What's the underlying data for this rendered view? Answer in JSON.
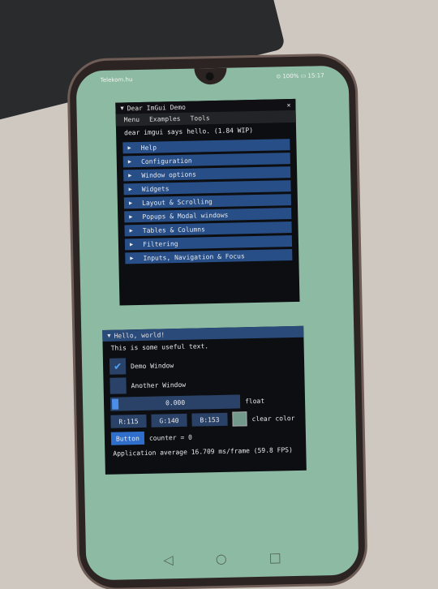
{
  "status": {
    "left": "Telekom.hu",
    "right": "⊙ 100% ▭ 15:17"
  },
  "demo_window": {
    "title": "Dear ImGui Demo",
    "close_glyph": "✕",
    "menu": [
      "Menu",
      "Examples",
      "Tools"
    ],
    "hello_line": "dear imgui says hello. (1.84 WIP)",
    "headers": [
      "Help",
      "Configuration",
      "Window options",
      "Widgets",
      "Layout & Scrolling",
      "Popups & Modal windows",
      "Tables & Columns",
      "Filtering",
      "Inputs, Navigation & Focus"
    ]
  },
  "hello_window": {
    "title": "Hello, world!",
    "text": "This is some useful text.",
    "check_demo": {
      "label": "Demo Window",
      "checked": true
    },
    "check_another": {
      "label": "Another Window",
      "checked": false
    },
    "slider": {
      "value": "0.000",
      "label": "float"
    },
    "color": {
      "r": "R:115",
      "g": "G:140",
      "b": "B:153",
      "label": "clear color",
      "swatch": "#73998c"
    },
    "button_label": "Button",
    "counter": "counter = 0",
    "perf": "Application average 16.709 ms/frame (59.8 FPS)"
  },
  "nav": {
    "back": "◁",
    "home": "○",
    "recent": "□"
  }
}
